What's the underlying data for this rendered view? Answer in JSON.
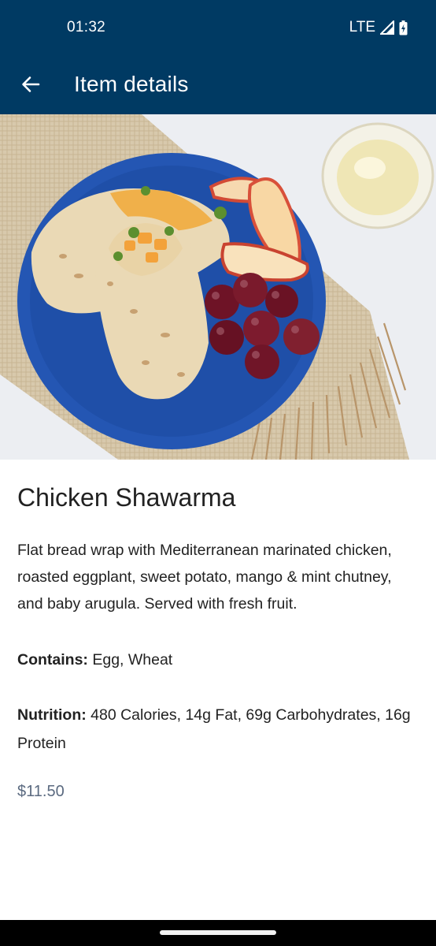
{
  "status_bar": {
    "time": "01:32",
    "network": "LTE"
  },
  "app_bar": {
    "title": "Item details"
  },
  "item": {
    "name": "Chicken Shawarma",
    "description": "Flat bread wrap with Mediterranean marinated chicken, roasted eggplant, sweet potato, mango & mint chutney, and baby arugula.  Served with fresh fruit.",
    "contains_label": "Contains:",
    "contains_value": " Egg, Wheat",
    "nutrition_label": "Nutrition:",
    "nutrition_value": " 480 Calories, 14g Fat, 69g Carbohydrates, 16g Protein",
    "price": "$11.50"
  },
  "colors": {
    "header": "#003a63",
    "price": "#5b6a80",
    "plate": "#1f4fa8"
  },
  "icons": {
    "back": "arrow-left-icon",
    "signal": "signal-icon",
    "battery": "battery-icon"
  }
}
